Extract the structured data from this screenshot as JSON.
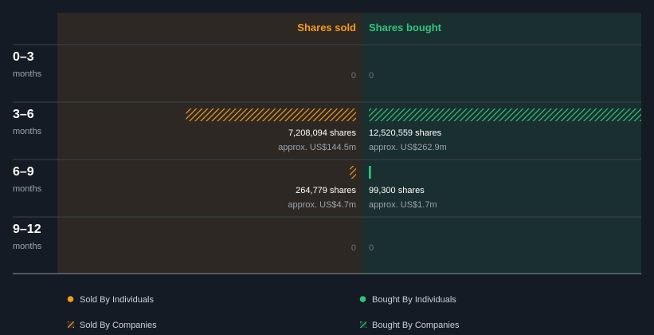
{
  "chart_data": {
    "type": "bar",
    "orientation": "horizontal-diverging",
    "columns": {
      "sold": "Shares sold",
      "bought": "Shares bought"
    },
    "categories": [
      {
        "label": "0–3",
        "unit": "months"
      },
      {
        "label": "3–6",
        "unit": "months"
      },
      {
        "label": "6–9",
        "unit": "months"
      },
      {
        "label": "9–12",
        "unit": "months"
      }
    ],
    "series": [
      {
        "name": "Shares sold",
        "side": "sold",
        "values": [
          0,
          7208094,
          264779,
          0
        ],
        "value_labels": [
          "0",
          "7,208,094 shares",
          "264,779 shares",
          "0"
        ],
        "amount_labels": [
          "",
          "approx. US$144.5m",
          "approx. US$4.7m",
          ""
        ]
      },
      {
        "name": "Shares bought",
        "side": "bought",
        "values": [
          0,
          12520559,
          99300,
          0
        ],
        "value_labels": [
          "0",
          "12,520,559 shares",
          "99,300 shares",
          "0"
        ],
        "amount_labels": [
          "",
          "approx. US$262.9m",
          "approx. US$1.7m",
          ""
        ]
      }
    ],
    "scale_max": 12520559,
    "legend": [
      {
        "label": "Sold By Individuals",
        "marker": "dot",
        "color": "#f39b1e"
      },
      {
        "label": "Bought By Individuals",
        "marker": "dot",
        "color": "#2fc57b"
      },
      {
        "label": "Sold By Companies",
        "marker": "hatch",
        "color": "#f39b1e"
      },
      {
        "label": "Bought By Companies",
        "marker": "hatch",
        "color": "#2fc57b"
      }
    ],
    "legend_position": "bottom",
    "colors": {
      "background": "#151b24",
      "sold_panel": "#2d2823",
      "bought_panel": "#1a2f2f",
      "sold": "#f39b1e",
      "bought": "#2fc57b",
      "divider": "#3a434c"
    }
  }
}
